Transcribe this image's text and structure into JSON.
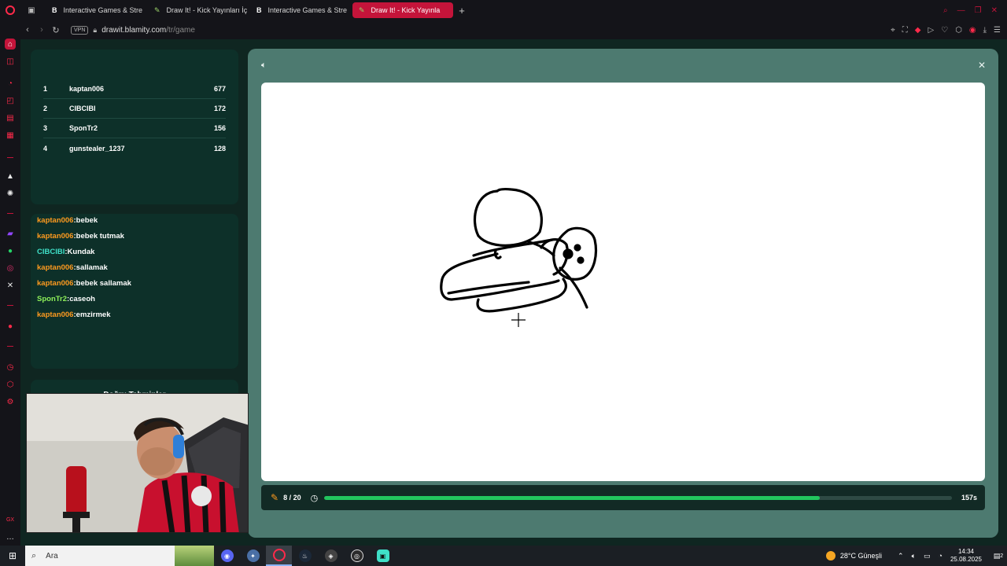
{
  "browser": {
    "tabs": [
      {
        "favicon": "B",
        "title": "Interactive Games & Stre",
        "active": false
      },
      {
        "favicon": "✎",
        "title": "Draw It! - Kick Yayınları İç",
        "active": false
      },
      {
        "favicon": "B",
        "title": "Interactive Games & Stre",
        "active": false
      },
      {
        "favicon": "✎",
        "title": "Draw It! - Kick Yayınla",
        "active": true
      }
    ],
    "new_tab": "+",
    "vpn_label": "VPN",
    "url_host": "drawit.blamity.com",
    "url_path": "/tr/game"
  },
  "leaderboard": [
    {
      "rank": "1",
      "name": "kaptan006",
      "score": "677"
    },
    {
      "rank": "2",
      "name": "CIBCIBI",
      "score": "172"
    },
    {
      "rank": "3",
      "name": "SponTr2",
      "score": "156"
    },
    {
      "rank": "4",
      "name": "gunstealer_1237",
      "score": "128"
    }
  ],
  "chat": [
    {
      "user": "kaptan006",
      "text": "bebek",
      "color": "#ff9b1f"
    },
    {
      "user": "kaptan006",
      "text": "bebek tutmak",
      "color": "#ff9b1f"
    },
    {
      "user": "CIBCIBI",
      "text": "Kundak",
      "color": "#3fe0c8"
    },
    {
      "user": "kaptan006",
      "text": "sallamak",
      "color": "#ff9b1f"
    },
    {
      "user": "kaptan006",
      "text": "bebek sallamak",
      "color": "#ff9b1f"
    },
    {
      "user": "SponTr2",
      "text": "caseoh",
      "color": "#8ef05a"
    },
    {
      "user": "kaptan006",
      "text": "emzirmek",
      "color": "#ff9b1f"
    }
  ],
  "panel3": {
    "title": "Doğru Tahminler"
  },
  "game": {
    "round": "8 / 20",
    "seconds": "157s",
    "progress": 0.79
  },
  "taskbar": {
    "search_placeholder": "Ara",
    "weather": "28°C  Güneşli",
    "time": "14:34",
    "date": "25.08.2025",
    "notifications": "2"
  },
  "colors": {
    "accent": "#c4143a",
    "page_bg": "#0f2621",
    "panel_bg": "#0d3029",
    "modal_bg": "#4d7a70",
    "progress": "#22c55e"
  }
}
